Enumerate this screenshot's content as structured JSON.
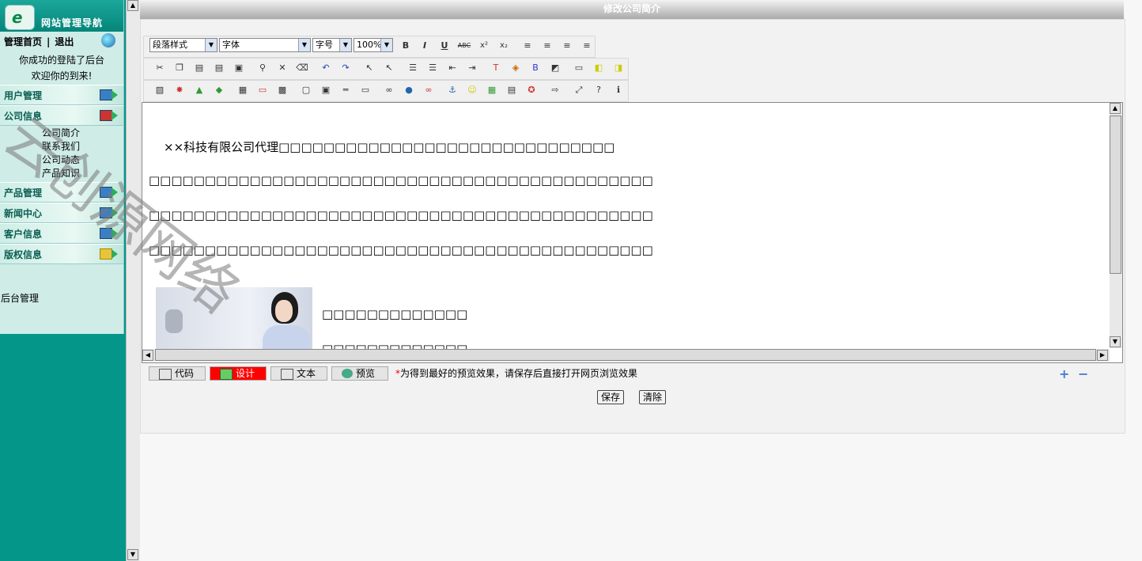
{
  "nav": {
    "title": "网站管理导航",
    "home": "管理首页",
    "separator": "|",
    "logout": "退出",
    "welcome_line1": "你成功的登陆了后台",
    "welcome_line2": "欢迎你的到来!",
    "menus": [
      {
        "label": "用户管理"
      },
      {
        "label": "公司信息",
        "items": [
          "公司简介",
          "联系我们",
          "公司动态",
          "产品知识"
        ]
      },
      {
        "label": "产品管理"
      },
      {
        "label": "新闻中心"
      },
      {
        "label": "客户信息"
      },
      {
        "label": "版权信息"
      }
    ],
    "footer": "后台管理"
  },
  "page": {
    "title": "修改公司简介"
  },
  "toolbar": {
    "paragraph_style": "段落样式",
    "font": "字体",
    "font_size": "字号",
    "zoom": "100%",
    "bold": "B",
    "italic": "I",
    "underline": "U",
    "strike": "ABC",
    "superscript": "x²",
    "subscript": "x₂"
  },
  "content": {
    "line1": "××科技有限公司代理□□□□□□□□□□□□□□□□□□□□□□□□□□□□□□",
    "line2": "□□□□□□□□□□□□□□□□□□□□□□□□□□□□□□□□□□□□□□□□□□□□□",
    "line3": "□□□□□□□□□□□□□□□□□□□□□□□□□□□□□□□□□□□□□□□□□□□□□",
    "line4": "□□□□□□□□□□□□□□□□□□□□□□□□□□□□□□□□□□□□□□□□□□□□□",
    "line5": "□□□□□□□□□□□□□",
    "line6": "□□□□□□□□□□□□□"
  },
  "modes": {
    "code": "代码",
    "design": "设计",
    "text": "文本",
    "preview": "预览"
  },
  "hint": {
    "star": "*",
    "text": "为得到最好的预览效果，请保存后直接打开网页浏览效果"
  },
  "zoom_in": "+",
  "zoom_out": "−",
  "actions": {
    "save": "保存",
    "clear": "清除"
  },
  "watermark": "云创源网络",
  "colors": {
    "sidebar": "#05968a",
    "design_active": "#ff0000"
  }
}
